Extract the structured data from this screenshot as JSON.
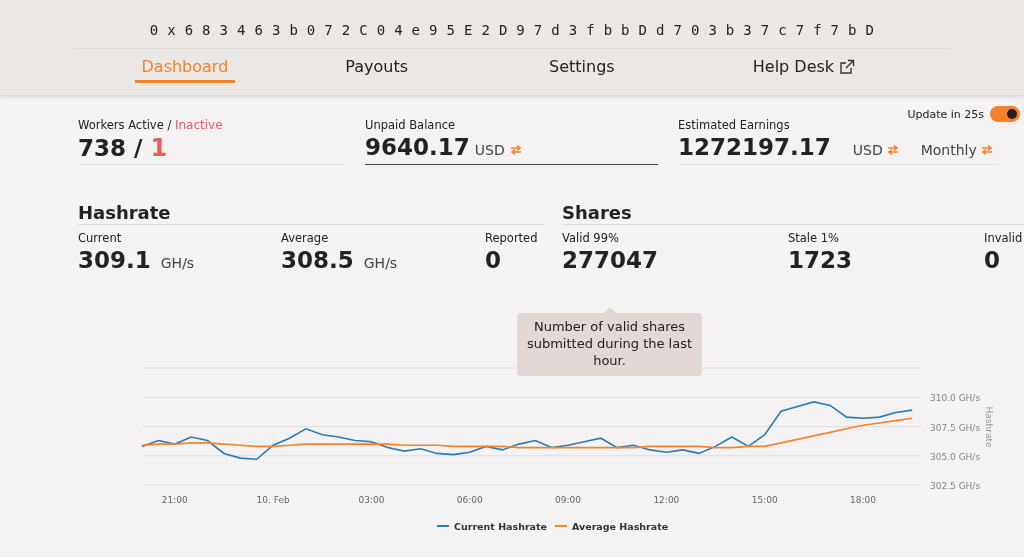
{
  "header": {
    "wallet_address": "0 x 6 8 3 4 6 3 b 0 7 2 C 0 4 e 9 5 E 2 D 9 7 d 3 f b b D d 7 0 3 b 3 7 c 7 f 7 b D"
  },
  "tabs": [
    {
      "label": "Dashboard",
      "selected": true,
      "external": false
    },
    {
      "label": "Payouts",
      "selected": false,
      "external": false
    },
    {
      "label": "Settings",
      "selected": false,
      "external": false
    },
    {
      "label": "Help Desk",
      "selected": false,
      "external": true
    }
  ],
  "auto_update": {
    "label": "Update in 25s",
    "on": true
  },
  "workers": {
    "label": "Workers Active",
    "separator": " / ",
    "inactive_label": "Inactive",
    "active": "738",
    "value_separator": " / ",
    "inactive": "1"
  },
  "unpaid_balance": {
    "label": "Unpaid Balance",
    "value": "9640.17",
    "unit": "USD"
  },
  "estimated_earnings": {
    "label": "Estimated Earnings",
    "value": "1272197.17",
    "unit": "USD",
    "period": "Monthly"
  },
  "hashrate": {
    "title": "Hashrate",
    "stats": [
      {
        "label": "Current",
        "value": "309.1",
        "unit": "GH/s"
      },
      {
        "label": "Average",
        "value": "308.5",
        "unit": "GH/s"
      },
      {
        "label": "Reported",
        "value": "0"
      }
    ]
  },
  "shares": {
    "title": "Shares",
    "stats": [
      {
        "label": "Valid 99%",
        "value": "277047"
      },
      {
        "label": "Stale 1%",
        "value": "1723"
      },
      {
        "label": "Invalid",
        "value": "0"
      }
    ]
  },
  "tooltip": {
    "text": "Number of valid shares submitted during the last hour."
  },
  "chart": {
    "chart_data": {
      "type": "line",
      "ylabel": "Hashrate",
      "categories": [
        null,
        null,
        "21:00",
        null,
        null,
        null,
        null,
        null,
        "10. Feb",
        null,
        null,
        null,
        null,
        null,
        "03:00",
        null,
        null,
        null,
        null,
        null,
        "06:00",
        null,
        null,
        null,
        null,
        null,
        "09:00",
        null,
        null,
        null,
        null,
        null,
        "12:00",
        null,
        null,
        null,
        null,
        null,
        "15:00",
        null,
        null,
        null,
        null,
        null,
        "18:00",
        null,
        null,
        null
      ],
      "series": [
        {
          "name": "Current Hashrate",
          "color": "#2a7bb5",
          "values": [
            305.8,
            306.3,
            306.0,
            306.6,
            306.3,
            305.2,
            304.8,
            304.7,
            305.9,
            306.5,
            307.3,
            306.8,
            306.6,
            306.3,
            306.2,
            305.7,
            305.4,
            305.6,
            305.2,
            305.1,
            305.3,
            305.8,
            305.5,
            306.0,
            306.3,
            305.7,
            305.9,
            306.2,
            306.5,
            305.7,
            305.9,
            305.5,
            305.3,
            305.5,
            305.2,
            305.8,
            306.6,
            305.8,
            306.8,
            308.8,
            309.2,
            309.6,
            309.3,
            308.3,
            308.2,
            308.3,
            308.7,
            308.9
          ]
        },
        {
          "name": "Average Hashrate",
          "color": "#f5822a",
          "values": [
            305.9,
            306.0,
            306.0,
            306.1,
            306.1,
            306.0,
            305.9,
            305.8,
            305.8,
            305.9,
            306.0,
            306.0,
            306.0,
            306.0,
            306.0,
            306.0,
            305.9,
            305.9,
            305.9,
            305.8,
            305.8,
            305.8,
            305.8,
            305.7,
            305.7,
            305.7,
            305.7,
            305.7,
            305.7,
            305.7,
            305.7,
            305.8,
            305.8,
            305.8,
            305.8,
            305.7,
            305.7,
            305.8,
            305.8,
            306.1,
            306.4,
            306.7,
            307.0,
            307.3,
            307.6,
            307.8,
            308.0,
            308.2
          ]
        }
      ],
      "ylim": [
        302.5,
        312.5
      ],
      "grid": true,
      "legend": "bottom",
      "yticks": [
        {
          "value": 302.5,
          "label": "302.5 GH/s"
        },
        {
          "value": 305,
          "label": "305.0 GH/s"
        },
        {
          "value": 307.5,
          "label": "307.5 GH/s"
        },
        {
          "value": 310,
          "label": "310.0 GH/s"
        }
      ]
    }
  }
}
